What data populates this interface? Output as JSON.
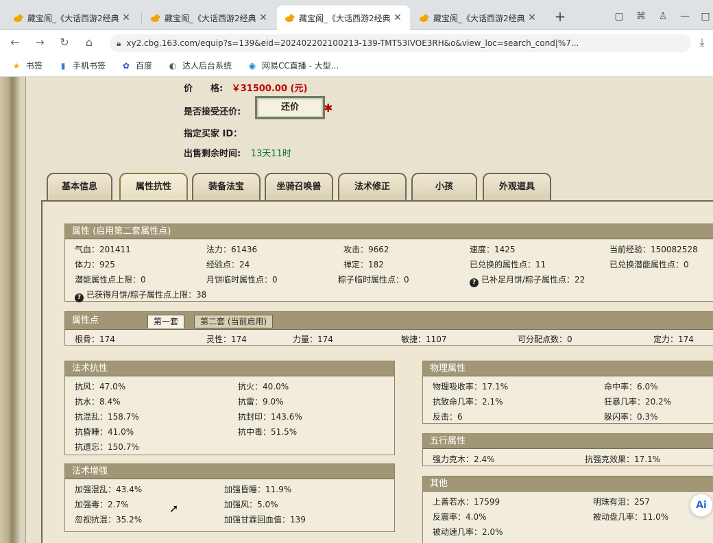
{
  "browser": {
    "tabs": [
      {
        "title": "藏宝阁_《大话西游2经典"
      },
      {
        "title": "藏宝阁_《大话西游2经典"
      },
      {
        "title": "藏宝阁_《大话西游2经典"
      },
      {
        "title": "藏宝阁_《大话西游2经典"
      }
    ],
    "active_tab": 2,
    "url": "xy2.cbg.163.com/equip?s=139&eid=202402202100213-139-TMT53IVOE3RH&o&view_loc=search_cond|%7...",
    "bookmarks": [
      "书签",
      "手机书签",
      "百度",
      "达人后台系统",
      "网易CC直播 - 大型..."
    ]
  },
  "info": {
    "price_label": "价　　格:",
    "price_value": "￥31500.00 (元)",
    "haggle_label": "是否接受还价:",
    "haggle_button": "还价",
    "buyer_label": "指定买家 ID：",
    "remain_label": "出售剩余时间:",
    "remain_value": "13天11时"
  },
  "main_tabs": [
    "基本信息",
    "属性抗性",
    "装备法宝",
    "坐骑召唤兽",
    "法术修正",
    "小孩",
    "外观道具"
  ],
  "active_main_tab": 1,
  "attr": {
    "title": "属性 (启用第二套属性点)",
    "rows": [
      [
        "气血：201411",
        "法力：61436",
        "攻击：9662",
        "速度：1425",
        "当前经验：150082528"
      ],
      [
        "体力：925",
        "经验点：24",
        "禅定：182",
        "已兑换的属性点：11",
        "已兑换潜能属性点：0"
      ],
      [
        "潜能属性点上限：0",
        "月饼临时属性点：0",
        "粽子临时属性点：0",
        "已补足月饼/粽子属性点：22"
      ]
    ],
    "bottom": "已获得月饼/粽子属性点上限：38"
  },
  "points": {
    "title": "属性点",
    "tab1": "第一套",
    "tab2": "第二套 (当前启用)",
    "values": [
      "根骨：174",
      "灵性：174",
      "力量：174",
      "敏捷：1107",
      "可分配点数：0",
      "定力：174"
    ]
  },
  "resist": {
    "title": "法术抗性",
    "items": [
      "抗风：47.0%",
      "抗火：40.0%",
      "抗水：8.4%",
      "抗雷：9.0%",
      "抗混乱：158.7%",
      "抗封印：143.6%",
      "抗昏睡：41.0%",
      "抗中毒：51.5%",
      "抗遗忘：150.7%"
    ]
  },
  "enhance": {
    "title": "法术增强",
    "items": [
      "加强混乱：43.4%",
      "加强昏睡：11.9%",
      "加强毒：2.7%",
      "加强风：5.0%",
      "忽视抗混：35.2%",
      "加强甘霖回血值：139"
    ]
  },
  "physical": {
    "title": "物理属性",
    "items": [
      "物理吸收率：17.1%",
      "命中率：6.0%",
      "抗致命几率：2.1%",
      "狂暴几率：20.2%",
      "反击：6",
      "躲闪率：0.3%"
    ]
  },
  "five": {
    "title": "五行属性",
    "items": [
      "强力克木：2.4%",
      "抗强克效果：17.1%"
    ]
  },
  "other": {
    "title": "其他",
    "items": [
      "上善若水：17599",
      "明珠有泪：257",
      "反震率：4.0%",
      "被动盘几率：11.0%",
      "被动速几率：2.0%"
    ]
  },
  "ai_badge": "Ai"
}
